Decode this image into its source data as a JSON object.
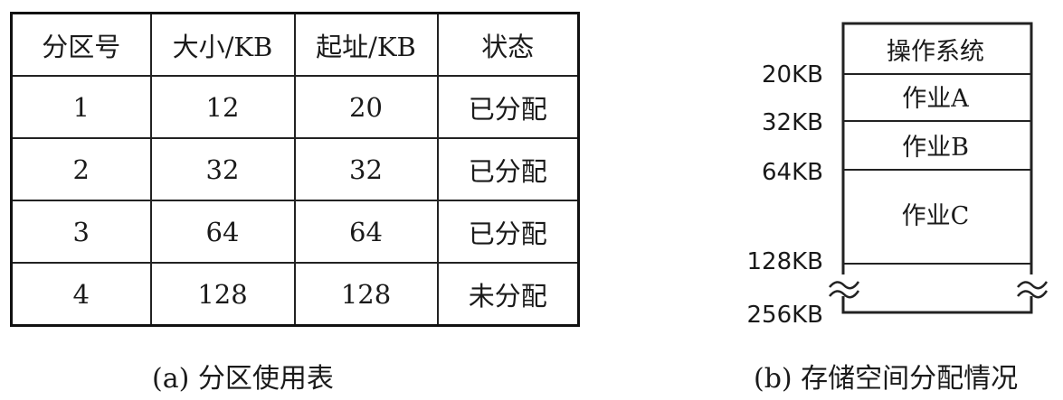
{
  "table": {
    "headers": [
      "分区号",
      "大小/KB",
      "起址/KB",
      "状态"
    ],
    "rows": [
      [
        "1",
        "12",
        "20",
        "已分配"
      ],
      [
        "2",
        "32",
        "32",
        "已分配"
      ],
      [
        "3",
        "64",
        "64",
        "已分配"
      ],
      [
        "4",
        "128",
        "128",
        "未分配"
      ]
    ]
  },
  "caption_a": "(a)  分区使用表",
  "memory": {
    "blocks": [
      "操作系统",
      "作业A",
      "作业B",
      "作业C"
    ],
    "addresses": [
      "20KB",
      "32KB",
      "64KB",
      "128KB",
      "256KB"
    ]
  },
  "caption_b": "(b)  存储空间分配情况"
}
